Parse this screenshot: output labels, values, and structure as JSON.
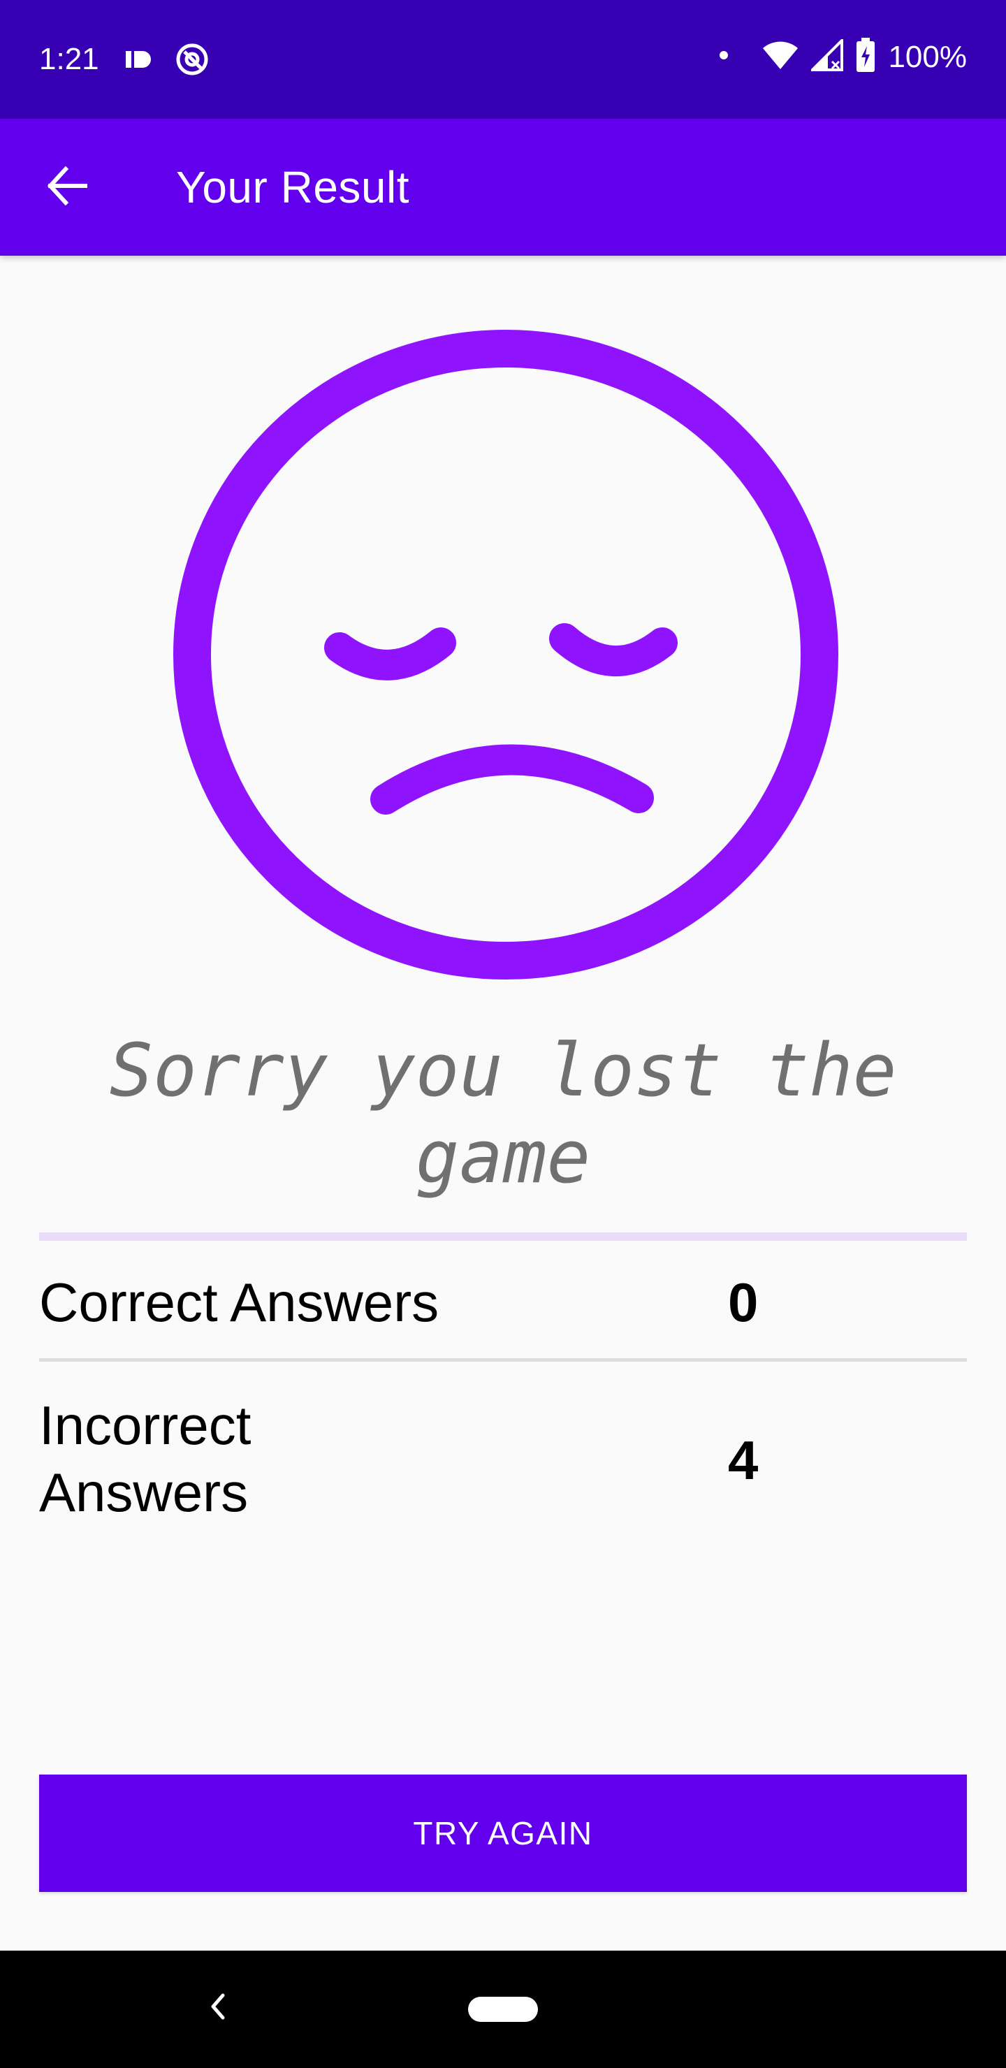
{
  "status_bar": {
    "time": "1:21",
    "battery": "100%",
    "icons": [
      "id-icon",
      "at-sign-icon",
      "dot-icon",
      "wifi-icon",
      "signal-icon",
      "battery-icon"
    ]
  },
  "app_bar": {
    "title": "Your Result",
    "back_icon": "arrow-left-icon"
  },
  "result": {
    "face_icon": "sad-face-icon",
    "message": "Sorry you lost the game"
  },
  "stats": {
    "correct_label": "Correct Answers",
    "correct_value": "0",
    "incorrect_label": "Incorrect Answers",
    "incorrect_value": "4"
  },
  "actions": {
    "try_again_label": "TRY AGAIN"
  },
  "nav_bar": {
    "back_icon": "chevron-left-icon",
    "home_icon": "home-pill-icon"
  },
  "colors": {
    "status_bar": "#3700b3",
    "app_bar": "#6200ee",
    "face": "#9013fe",
    "message": "#707070",
    "button": "#6200ee",
    "purple_divider": "#e8dcf8"
  }
}
